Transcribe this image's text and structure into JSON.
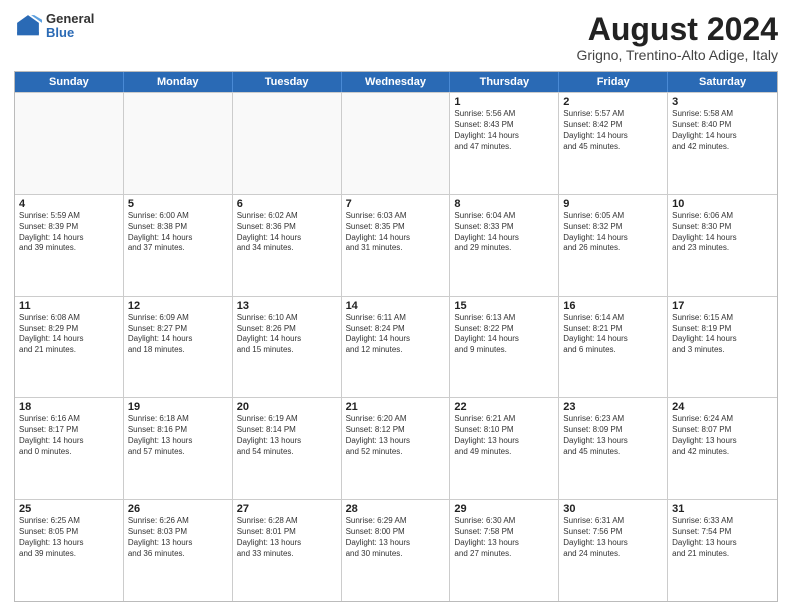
{
  "header": {
    "logo": {
      "general": "General",
      "blue": "Blue"
    },
    "title": "August 2024",
    "location": "Grigno, Trentino-Alto Adige, Italy"
  },
  "days_of_week": [
    "Sunday",
    "Monday",
    "Tuesday",
    "Wednesday",
    "Thursday",
    "Friday",
    "Saturday"
  ],
  "rows": [
    [
      {
        "day": "",
        "info": "",
        "empty": true
      },
      {
        "day": "",
        "info": "",
        "empty": true
      },
      {
        "day": "",
        "info": "",
        "empty": true
      },
      {
        "day": "",
        "info": "",
        "empty": true
      },
      {
        "day": "1",
        "info": "Sunrise: 5:56 AM\nSunset: 8:43 PM\nDaylight: 14 hours\nand 47 minutes."
      },
      {
        "day": "2",
        "info": "Sunrise: 5:57 AM\nSunset: 8:42 PM\nDaylight: 14 hours\nand 45 minutes."
      },
      {
        "day": "3",
        "info": "Sunrise: 5:58 AM\nSunset: 8:40 PM\nDaylight: 14 hours\nand 42 minutes."
      }
    ],
    [
      {
        "day": "4",
        "info": "Sunrise: 5:59 AM\nSunset: 8:39 PM\nDaylight: 14 hours\nand 39 minutes."
      },
      {
        "day": "5",
        "info": "Sunrise: 6:00 AM\nSunset: 8:38 PM\nDaylight: 14 hours\nand 37 minutes."
      },
      {
        "day": "6",
        "info": "Sunrise: 6:02 AM\nSunset: 8:36 PM\nDaylight: 14 hours\nand 34 minutes."
      },
      {
        "day": "7",
        "info": "Sunrise: 6:03 AM\nSunset: 8:35 PM\nDaylight: 14 hours\nand 31 minutes."
      },
      {
        "day": "8",
        "info": "Sunrise: 6:04 AM\nSunset: 8:33 PM\nDaylight: 14 hours\nand 29 minutes."
      },
      {
        "day": "9",
        "info": "Sunrise: 6:05 AM\nSunset: 8:32 PM\nDaylight: 14 hours\nand 26 minutes."
      },
      {
        "day": "10",
        "info": "Sunrise: 6:06 AM\nSunset: 8:30 PM\nDaylight: 14 hours\nand 23 minutes."
      }
    ],
    [
      {
        "day": "11",
        "info": "Sunrise: 6:08 AM\nSunset: 8:29 PM\nDaylight: 14 hours\nand 21 minutes."
      },
      {
        "day": "12",
        "info": "Sunrise: 6:09 AM\nSunset: 8:27 PM\nDaylight: 14 hours\nand 18 minutes."
      },
      {
        "day": "13",
        "info": "Sunrise: 6:10 AM\nSunset: 8:26 PM\nDaylight: 14 hours\nand 15 minutes."
      },
      {
        "day": "14",
        "info": "Sunrise: 6:11 AM\nSunset: 8:24 PM\nDaylight: 14 hours\nand 12 minutes."
      },
      {
        "day": "15",
        "info": "Sunrise: 6:13 AM\nSunset: 8:22 PM\nDaylight: 14 hours\nand 9 minutes."
      },
      {
        "day": "16",
        "info": "Sunrise: 6:14 AM\nSunset: 8:21 PM\nDaylight: 14 hours\nand 6 minutes."
      },
      {
        "day": "17",
        "info": "Sunrise: 6:15 AM\nSunset: 8:19 PM\nDaylight: 14 hours\nand 3 minutes."
      }
    ],
    [
      {
        "day": "18",
        "info": "Sunrise: 6:16 AM\nSunset: 8:17 PM\nDaylight: 14 hours\nand 0 minutes."
      },
      {
        "day": "19",
        "info": "Sunrise: 6:18 AM\nSunset: 8:16 PM\nDaylight: 13 hours\nand 57 minutes."
      },
      {
        "day": "20",
        "info": "Sunrise: 6:19 AM\nSunset: 8:14 PM\nDaylight: 13 hours\nand 54 minutes."
      },
      {
        "day": "21",
        "info": "Sunrise: 6:20 AM\nSunset: 8:12 PM\nDaylight: 13 hours\nand 52 minutes."
      },
      {
        "day": "22",
        "info": "Sunrise: 6:21 AM\nSunset: 8:10 PM\nDaylight: 13 hours\nand 49 minutes."
      },
      {
        "day": "23",
        "info": "Sunrise: 6:23 AM\nSunset: 8:09 PM\nDaylight: 13 hours\nand 45 minutes."
      },
      {
        "day": "24",
        "info": "Sunrise: 6:24 AM\nSunset: 8:07 PM\nDaylight: 13 hours\nand 42 minutes."
      }
    ],
    [
      {
        "day": "25",
        "info": "Sunrise: 6:25 AM\nSunset: 8:05 PM\nDaylight: 13 hours\nand 39 minutes."
      },
      {
        "day": "26",
        "info": "Sunrise: 6:26 AM\nSunset: 8:03 PM\nDaylight: 13 hours\nand 36 minutes."
      },
      {
        "day": "27",
        "info": "Sunrise: 6:28 AM\nSunset: 8:01 PM\nDaylight: 13 hours\nand 33 minutes."
      },
      {
        "day": "28",
        "info": "Sunrise: 6:29 AM\nSunset: 8:00 PM\nDaylight: 13 hours\nand 30 minutes."
      },
      {
        "day": "29",
        "info": "Sunrise: 6:30 AM\nSunset: 7:58 PM\nDaylight: 13 hours\nand 27 minutes."
      },
      {
        "day": "30",
        "info": "Sunrise: 6:31 AM\nSunset: 7:56 PM\nDaylight: 13 hours\nand 24 minutes."
      },
      {
        "day": "31",
        "info": "Sunrise: 6:33 AM\nSunset: 7:54 PM\nDaylight: 13 hours\nand 21 minutes."
      }
    ]
  ]
}
